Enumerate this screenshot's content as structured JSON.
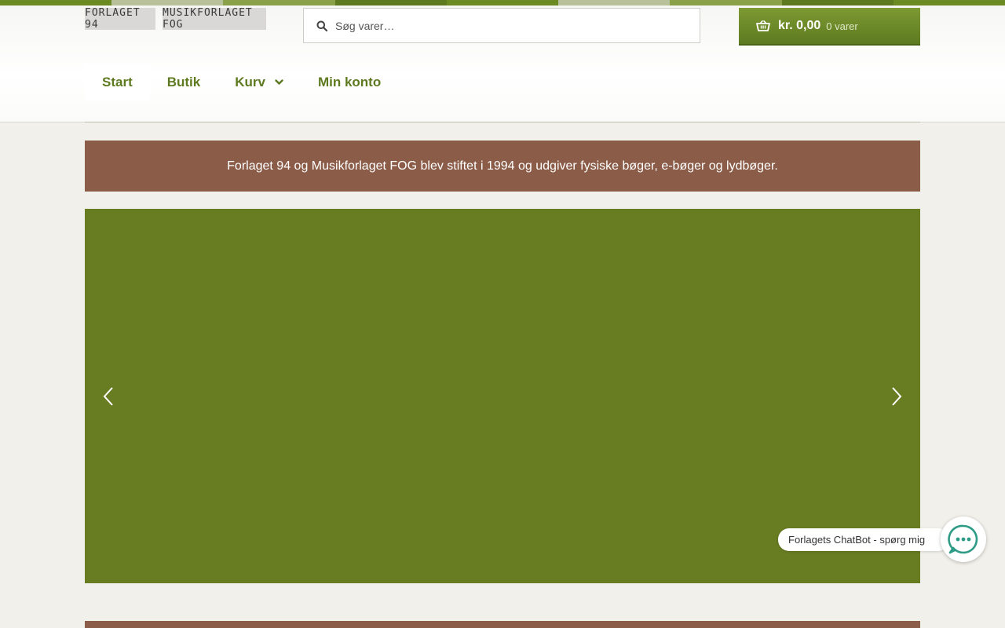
{
  "colors": {
    "accent_green": "#5e7a20",
    "hero_green": "#687c22",
    "banner_brown": "#8b5d49",
    "topbar": [
      "#6b8a22",
      "#b7c29b",
      "#8aa14a",
      "#5e7a20",
      "#6b8a22",
      "#b7c29b",
      "#8aa14a",
      "#5e7a20",
      "#6b8a22"
    ]
  },
  "header": {
    "logo1": "FORLAGET 94",
    "logo2": "MUSIKFORLAGET FOG",
    "search": {
      "placeholder": "Søg varer…",
      "icon": "search-icon"
    },
    "cart": {
      "amount": "kr. 0,00",
      "count": "0 varer",
      "icon": "basket-icon"
    }
  },
  "nav": {
    "items": [
      {
        "label": "Start",
        "active": true
      },
      {
        "label": "Butik"
      },
      {
        "label": "Kurv",
        "has_dropdown": true
      },
      {
        "label": "Min konto"
      }
    ]
  },
  "banner": {
    "text": "Forlaget 94 og Musikforlaget FOG blev stiftet i 1994 og udgiver fysiske bøger, e-bøger og lydbøger."
  },
  "hero": {
    "prev_icon": "chevron-left-icon",
    "next_icon": "chevron-right-icon"
  },
  "chatbot": {
    "label": "Forlagets ChatBot - spørg mig",
    "icon": "chat-bubble-icon"
  }
}
